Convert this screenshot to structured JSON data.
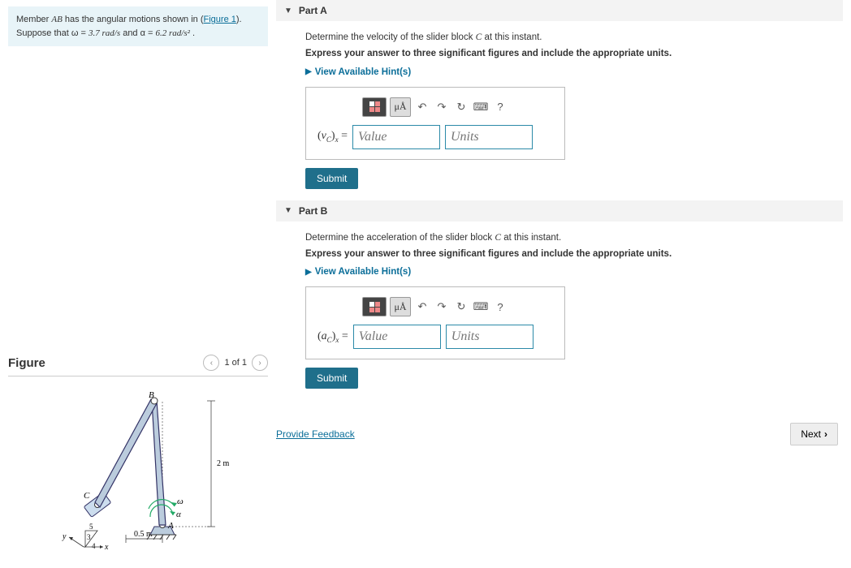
{
  "problem": {
    "text_prefix": "Member ",
    "member": "AB",
    "text_mid": " has the angular motions shown in (",
    "figure_link": "Figure 1",
    "text_suffix": ").",
    "suppose_prefix": "Suppose that ω = ",
    "omega_val": "3.7 rad/s",
    "and_text": " and α = ",
    "alpha_val": "6.2 rad/s²",
    "period": " ."
  },
  "figure": {
    "title": "Figure",
    "counter": "1 of 1",
    "labels": {
      "B": "B",
      "C": "C",
      "A": "A",
      "omega": "ω",
      "alpha": "α",
      "h": "2 m",
      "w": "0.5 m",
      "ang5": "5",
      "ang3": "3",
      "ang4": "4",
      "y": "y",
      "x": "x"
    }
  },
  "partA": {
    "title": "Part A",
    "prompt_pre": "Determine the velocity of the slider block ",
    "prompt_var": "C",
    "prompt_post": " at this instant.",
    "instr": "Express your answer to three significant figures and include the appropriate units.",
    "hint": "View Available Hint(s)",
    "var_html": "(v_C)_x =",
    "value_ph": "Value",
    "units_ph": "Units",
    "symbol_btn": "μÅ",
    "submit": "Submit"
  },
  "partB": {
    "title": "Part B",
    "prompt_pre": "Determine the acceleration of the slider block ",
    "prompt_var": "C",
    "prompt_post": " at this instant.",
    "instr": "Express your answer to three significant figures and include the appropriate units.",
    "hint": "View Available Hint(s)",
    "var_html": "(a_C)_x =",
    "value_ph": "Value",
    "units_ph": "Units",
    "symbol_btn": "μÅ",
    "submit": "Submit"
  },
  "footer": {
    "feedback": "Provide Feedback",
    "next": "Next"
  },
  "icons": {
    "undo": "↶",
    "redo": "↷",
    "reset": "↻",
    "keyboard": "⌨",
    "help": "?",
    "prev": "‹",
    "nextfig": "›",
    "caret": "▼",
    "tri": "▶",
    "chev": "›"
  }
}
